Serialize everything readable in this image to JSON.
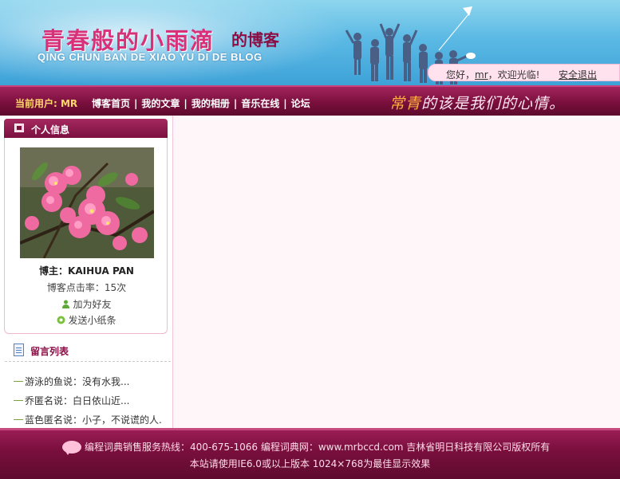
{
  "header": {
    "title_cn": "青春般的小雨滴",
    "title_suffix": "的博客",
    "title_en": "QING CHUN BAN DE XIAO YU DI DE BLOG",
    "greeting_before": "您好，",
    "greeting_user": "mr",
    "greeting_after": "，欢迎光临!",
    "logout": "安全退出"
  },
  "nav": {
    "current_user": "当前用户: MR",
    "links": [
      "博客首页",
      "我的文章",
      "我的相册",
      "音乐在线",
      "论坛"
    ],
    "slogan_hl": "常青",
    "slogan_rest": "的该是我们的心情。"
  },
  "sidebar": {
    "profile_title": "个人信息",
    "blogger": "博主：KAIHUA PAN",
    "hits": "博客点击率：15次",
    "add_friend": "加为好友",
    "send_note": "发送小纸条",
    "messages_title": "留言列表",
    "messages": [
      "游泳的鱼说：没有水我...",
      "乔匿名说：白日依山近...",
      "蓝色匿名说：小子，不说谎的人."
    ]
  },
  "footer": {
    "line1": "编程词典销售服务热线：400-675-1066    编程词典网：www.mrbccd.com    吉林省明日科技有限公司版权所有",
    "line2": "本站请使用IE6.0或以上版本 1024×768为最佳显示效果"
  },
  "colors": {
    "brand": "#7a0f3d",
    "accent": "#d9307a",
    "sky": "#5bb9e4"
  }
}
